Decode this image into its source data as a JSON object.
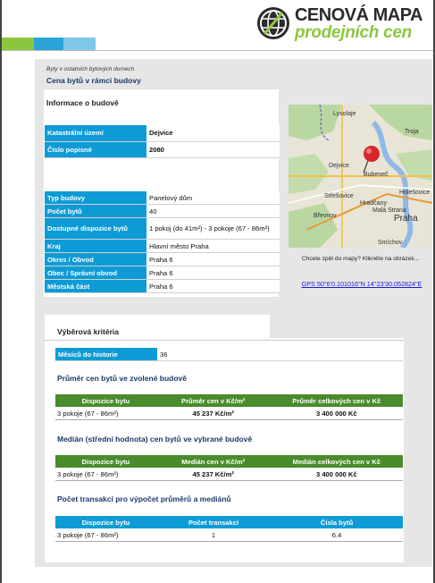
{
  "header": {
    "logo_top": "CENOVÁ MAPA",
    "logo_bottom": "prodejních cen",
    "stripe_colors": [
      "#8cc63f",
      "#29a3d8",
      "#7fc8ea"
    ]
  },
  "breadcrumb": "Byty v ostatních bytových domech",
  "page_title": "Cena bytů v rámci budovy",
  "building_info": {
    "section_title": "Informace o budově",
    "group1": [
      {
        "key": "Katastrální území",
        "value": "Dejvice"
      },
      {
        "key": "Číslo popisné",
        "value": "2080"
      }
    ],
    "group2": [
      {
        "key": "Typ budovy",
        "value": "Panelový dům"
      },
      {
        "key": "Počet bytů",
        "value": "40"
      },
      {
        "key": "Dostupné dispozice bytů",
        "value": "1 pokoj (do 41m²) - 3 pokoje (67 - 86m²)"
      },
      {
        "key": "Kraj",
        "value": "Hlavní město Praha"
      },
      {
        "key": "Okres / Obvod",
        "value": "Praha 6"
      },
      {
        "key": "Obec / Správní obvod",
        "value": "Praha 6"
      },
      {
        "key": "Městská část",
        "value": "Praha 6"
      }
    ]
  },
  "map": {
    "labels": [
      "Lysolaje",
      "Troja",
      "Dejvice",
      "Bubeneč",
      "Střešovice",
      "Hradčany",
      "Holešovice",
      "Malá Strana",
      "Břevnov",
      "Praha",
      "Smíchov"
    ],
    "caption": "Chcete zpět do mapy? Klikněte na obrázek...",
    "gps": "GPS 50°6'0.101016\"N 14°23'30.052824\"E"
  },
  "criteria": {
    "title": "Výběrová kritéria",
    "months_label": "Měsíců do historie",
    "months_value": "36"
  },
  "avg_section": {
    "title": "Průměr cen bytů ve zvolené budově",
    "headers": [
      "Dispozice bytu",
      "Průměr cen v Kč/m²",
      "Průměr celkových cen v Kč"
    ],
    "row": [
      "3 pokoje (67 - 86m²)",
      "45 237 Kč/m²",
      "3 400 000 Kč"
    ]
  },
  "median_section": {
    "title": "Medián (střední hodnota) cen bytů ve vybrané budově",
    "headers": [
      "Dispozice bytu",
      "Medián cen v Kč/m²",
      "Medián celkových cen v Kč"
    ],
    "row": [
      "3 pokoje (67 - 86m²)",
      "45 237 Kč/m²",
      "3 400 000 Kč"
    ]
  },
  "count_section": {
    "title": "Počet transakcí pro výpočet průměrů a mediánů",
    "headers": [
      "Dispozice bytu",
      "Počet transakcí",
      "Čísla bytů"
    ],
    "row": [
      "3 pokoje (67 - 86m²)",
      "1",
      "6.4"
    ]
  }
}
